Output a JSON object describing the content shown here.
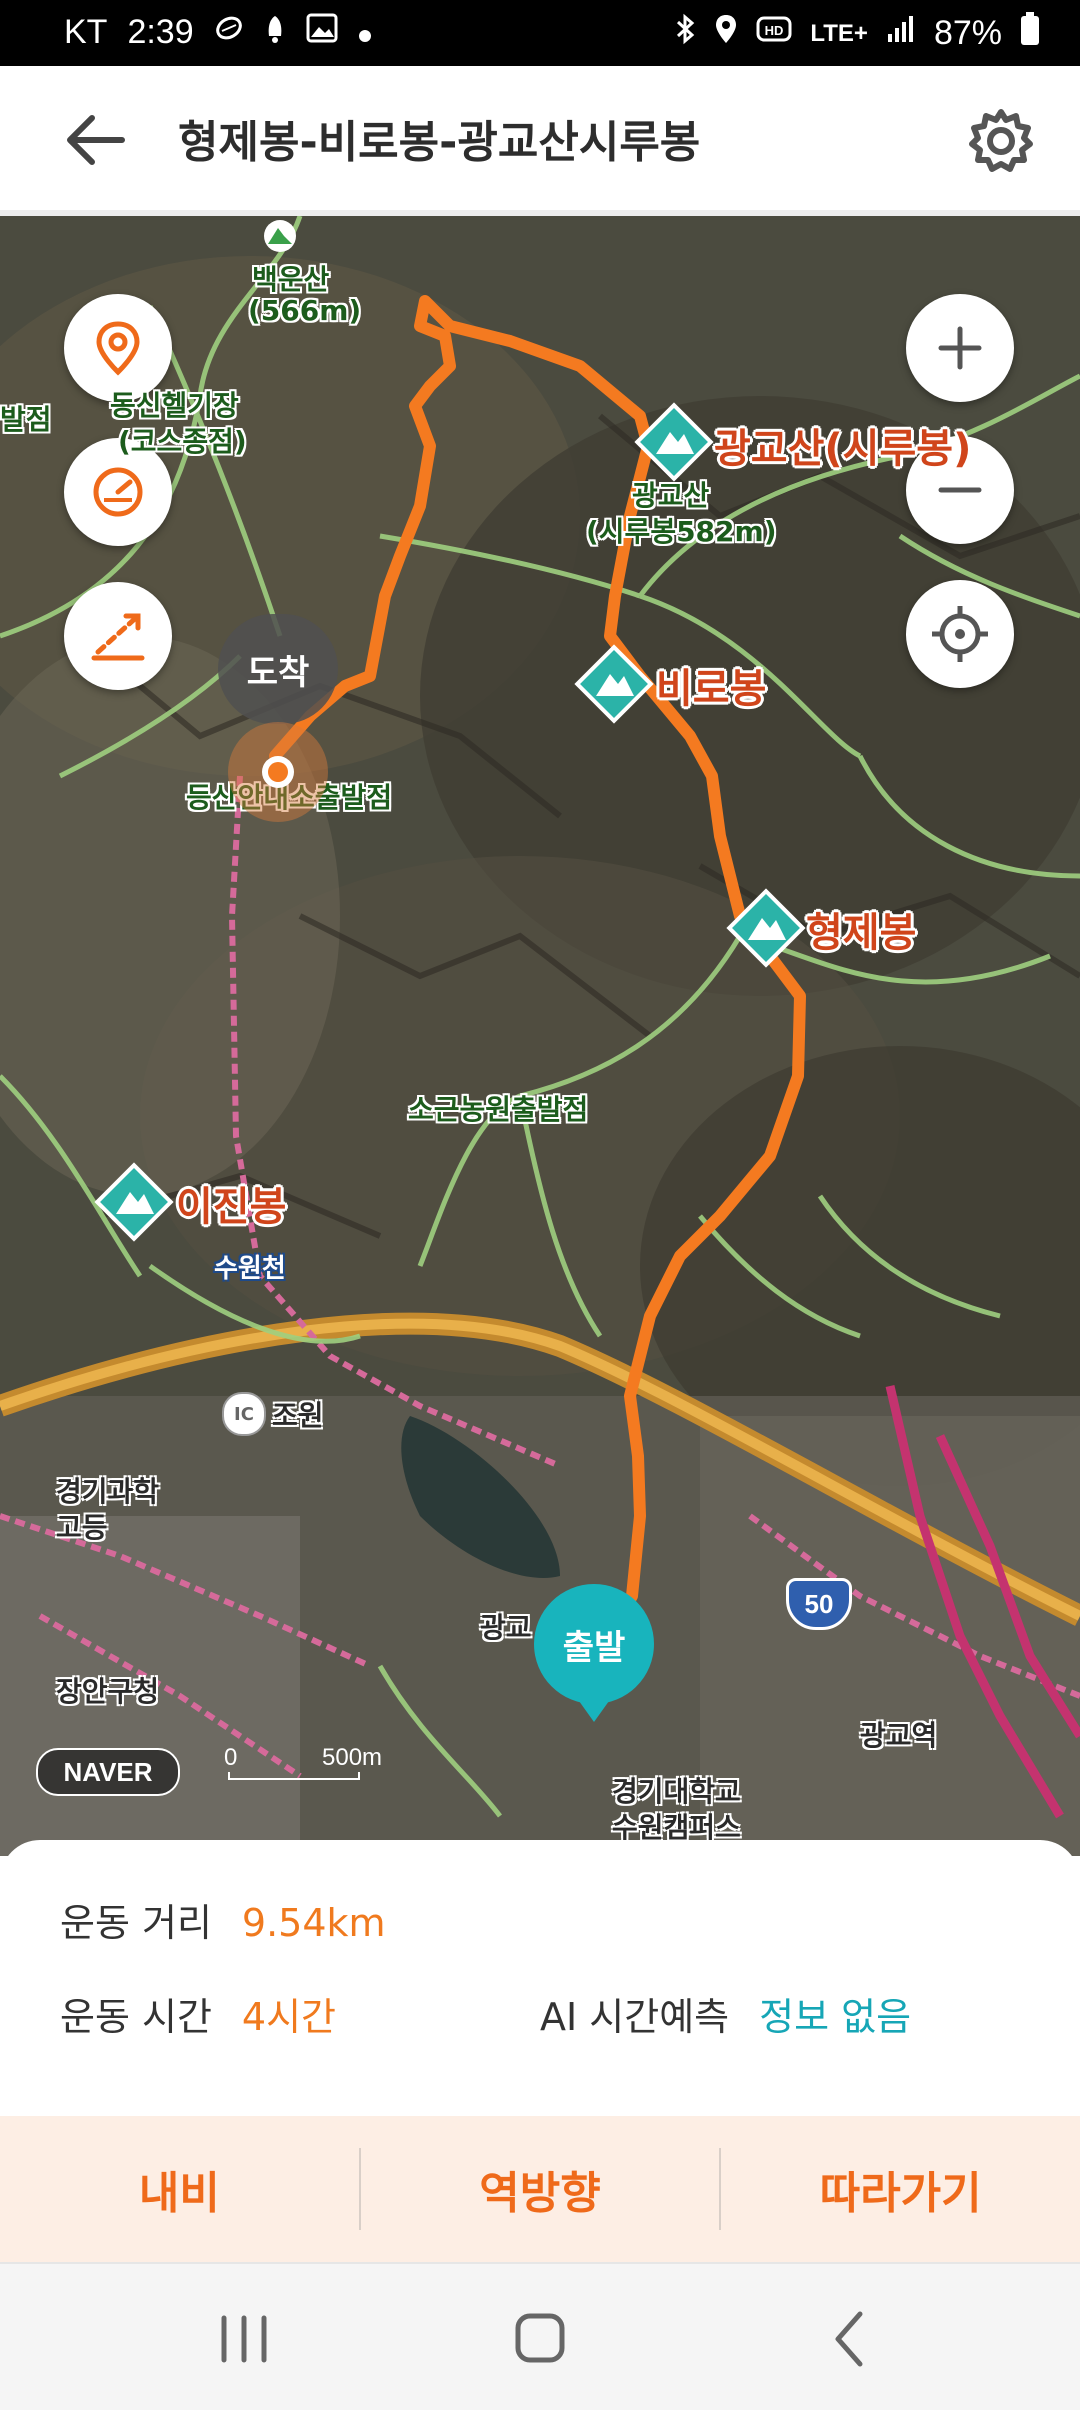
{
  "status_bar": {
    "carrier": "KT",
    "time": "2:39",
    "network": "LTE+",
    "battery": "87%",
    "icons": [
      "pedometer-icon",
      "bell-icon",
      "image-icon",
      "dot-icon",
      "bluetooth-icon",
      "location-icon",
      "hd-icon",
      "signal-icon",
      "battery-icon"
    ]
  },
  "header": {
    "title": "형제봉-비로봉-광교산시루봉",
    "back_icon": "back-arrow-icon",
    "settings_icon": "gear-icon"
  },
  "map": {
    "left_controls": [
      "location-pin-icon",
      "speedometer-icon",
      "elevation-slope-icon"
    ],
    "right_controls": [
      "zoom-in-icon",
      "zoom-out-icon",
      "my-location-icon"
    ],
    "labels": {
      "baekunsan": "백운산",
      "baekunsan_alt": "(566m)",
      "heli_1": "동신헬기장",
      "heli_2": "(코스종점)",
      "bal_jeom": "발점",
      "gwanggyo_peak": "광교산(시루봉)",
      "gwanggyo_sub1": "광교산",
      "gwanggyo_sub2": "(시루봉582m)",
      "birobong": "비로봉",
      "hyeongjebong": "형제봉",
      "trail_start": "등산안내소출발점",
      "sogeun": "소근농원출발점",
      "ijinbong": "이진봉",
      "suwoncheon": "수원천",
      "jowon": "조원",
      "ic_badge": "IC",
      "gyeonggi_sci_1": "경기과학",
      "gyeonggi_sci_2": "고등",
      "jangan": "장안구청",
      "gwanggyo_short": "광교",
      "gwanggyo_station": "광교역",
      "univ_1": "경기대학교",
      "univ_2": "수원캠퍼스",
      "route_50": "50"
    },
    "arrive_label": "도착",
    "depart_label": "출발",
    "naver_logo": "NAVER",
    "scale_zero": "0",
    "scale_distance": "500m"
  },
  "stats": {
    "distance_label": "운동 거리",
    "distance_value": "9.54km",
    "time_label": "운동 시간",
    "time_value": "4시간",
    "ai_label": "AI 시간예측",
    "ai_value": "정보 없음"
  },
  "actions": {
    "navigate": "내비",
    "reverse": "역방향",
    "follow": "따라가기"
  },
  "colors": {
    "route": "#f47a20",
    "accent_orange": "#ef6a1a",
    "teal": "#16a6b6",
    "peak_marker": "#2bb3a8"
  }
}
